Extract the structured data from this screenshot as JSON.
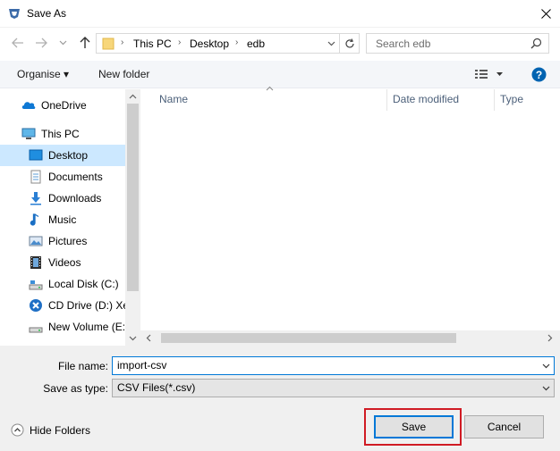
{
  "window": {
    "title": "Save As"
  },
  "address": {
    "crumbs": [
      "This PC",
      "Desktop",
      "edb"
    ],
    "separator": "›"
  },
  "search": {
    "placeholder": "Search edb"
  },
  "toolbar": {
    "organise": "Organise ▾",
    "new_folder": "New folder"
  },
  "sidebar": {
    "items": [
      {
        "label": "OneDrive",
        "icon": "onedrive-icon"
      },
      {
        "label": "This PC",
        "icon": "pc-icon"
      },
      {
        "label": "Desktop",
        "icon": "desktop-icon",
        "selected": true
      },
      {
        "label": "Documents",
        "icon": "documents-icon"
      },
      {
        "label": "Downloads",
        "icon": "downloads-icon"
      },
      {
        "label": "Music",
        "icon": "music-icon"
      },
      {
        "label": "Pictures",
        "icon": "pictures-icon"
      },
      {
        "label": "Videos",
        "icon": "videos-icon"
      },
      {
        "label": "Local Disk (C:)",
        "icon": "disk-icon"
      },
      {
        "label": "CD Drive (D:) Xen",
        "icon": "cd-drive-icon"
      },
      {
        "label": "New Volume (E:)",
        "icon": "disk-icon"
      }
    ]
  },
  "filelist": {
    "columns": [
      "Name",
      "Date modified",
      "Type"
    ]
  },
  "form": {
    "filename_label": "File name:",
    "filename_value": "import-csv",
    "savetype_label": "Save as type:",
    "savetype_value": "CSV Files(*.csv)"
  },
  "footer": {
    "hide_folders": "Hide Folders",
    "save": "Save",
    "cancel": "Cancel"
  },
  "colors": {
    "accent": "#0078d7",
    "selection": "#cce8ff",
    "highlight_box": "#d01b24",
    "help": "#0063b1"
  }
}
